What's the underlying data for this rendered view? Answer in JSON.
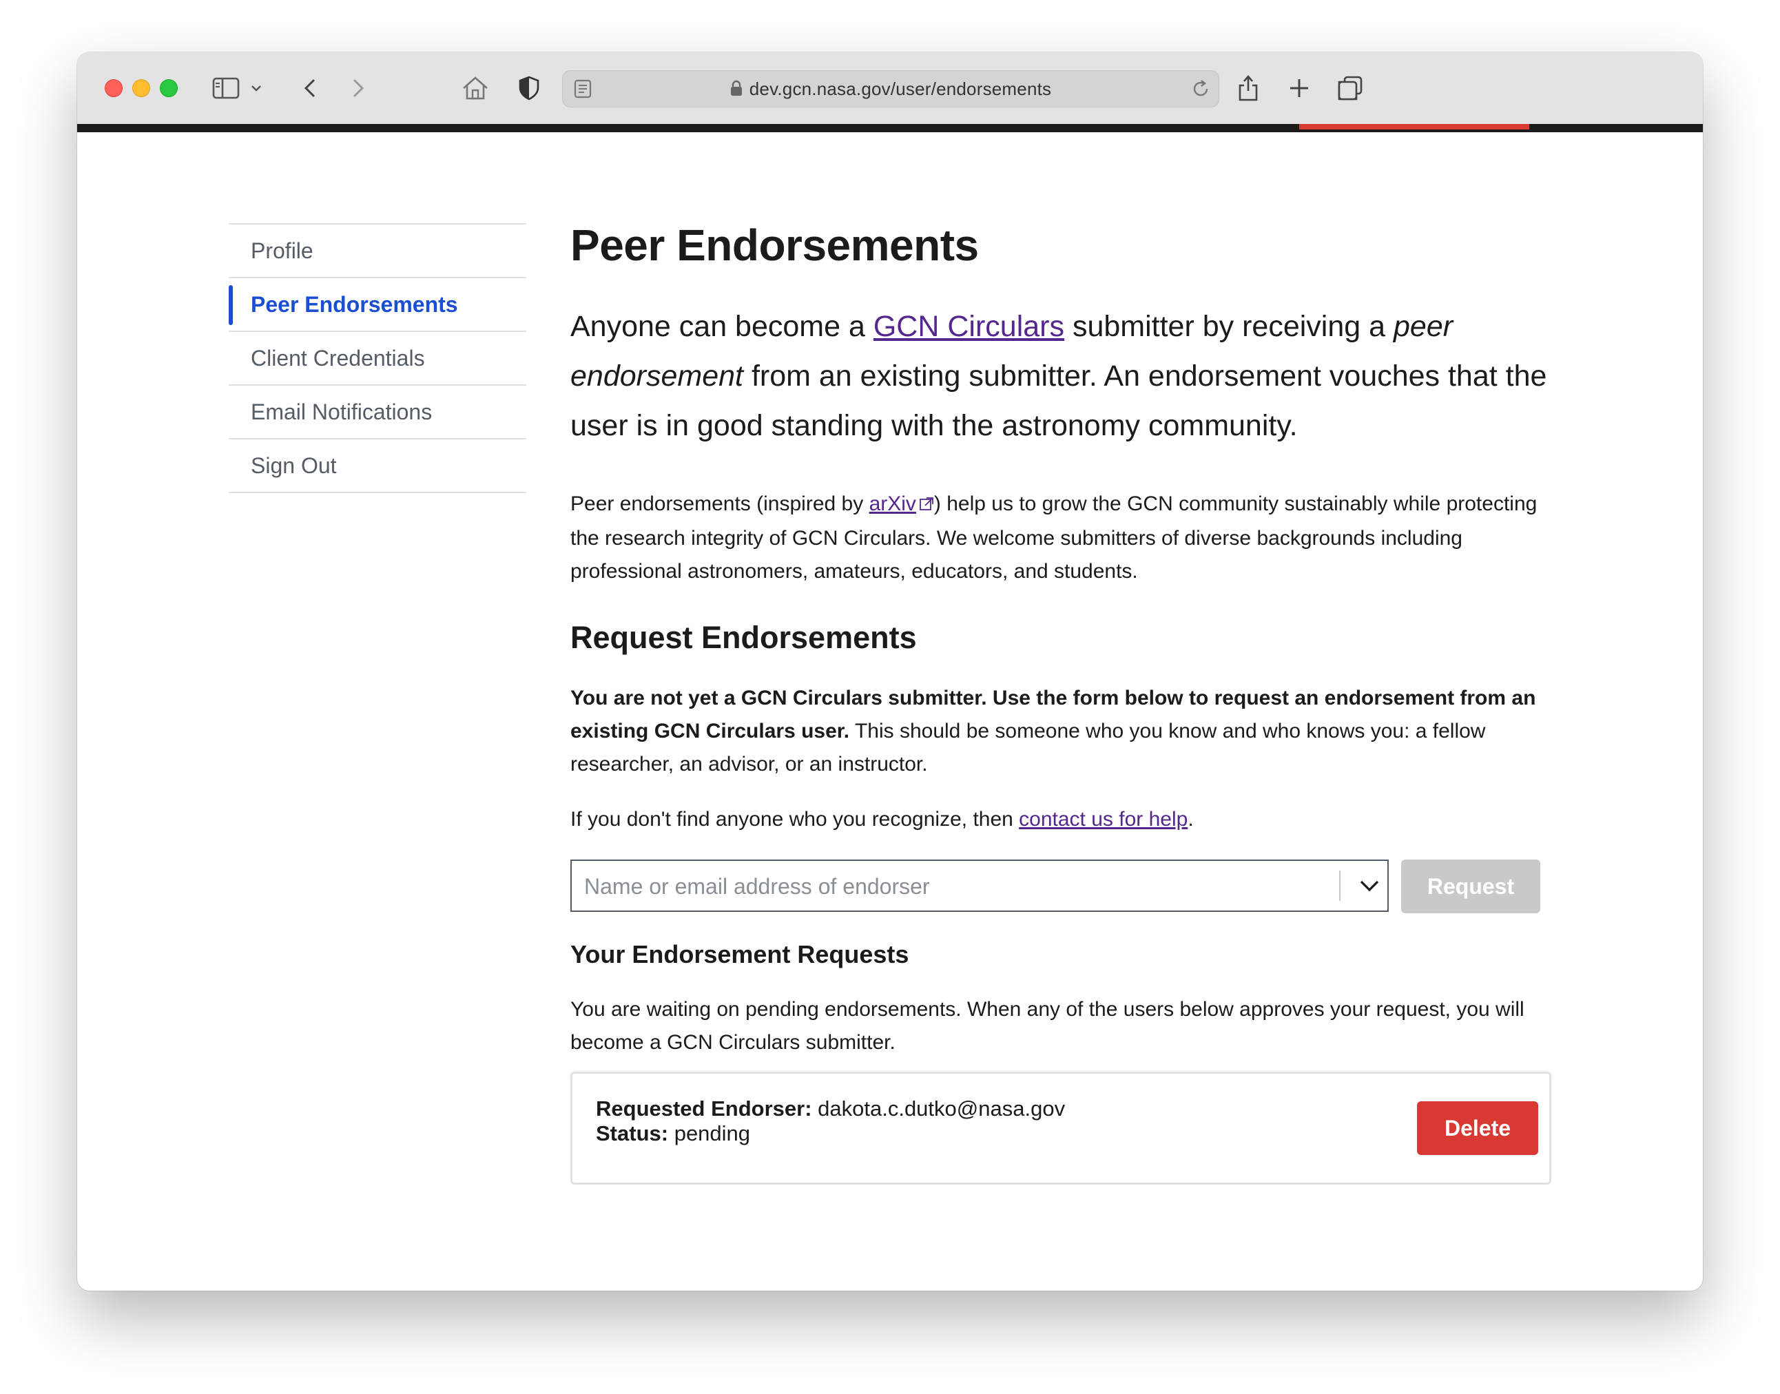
{
  "browser": {
    "url": "dev.gcn.nasa.gov/user/endorsements"
  },
  "sidebar": {
    "items": [
      {
        "label": "Profile"
      },
      {
        "label": "Peer Endorsements"
      },
      {
        "label": "Client Credentials"
      },
      {
        "label": "Email Notifications"
      },
      {
        "label": "Sign Out"
      }
    ],
    "active_index": 1
  },
  "main": {
    "title": "Peer Endorsements",
    "lead": {
      "part1": "Anyone can become a ",
      "link": "GCN Circulars",
      "part2": " submitter by receiving a ",
      "em": "peer endorsement",
      "part3": " from an existing submitter. An endorsement vouches that the user is in good standing with the astronomy community."
    },
    "intro": {
      "part1": "Peer endorsements (inspired by ",
      "link": "arXiv",
      "part2": ") help us to grow the GCN community sustainably while protecting the research integrity of GCN Circulars. We welcome submitters of diverse backgrounds including professional astronomers, amateurs, educators, and students."
    },
    "request_heading": "Request Endorsements",
    "request_bold": "You are not yet a GCN Circulars submitter. Use the form below to request an endorsement from an existing GCN Circulars user.",
    "request_rest": " This should be someone who you know and who knows you: a fellow researcher, an advisor, or an instructor.",
    "help": {
      "part1": "If you don't find anyone who you recognize, then ",
      "link": "contact us for help",
      "part2": "."
    },
    "search": {
      "placeholder": "Name or email address of endorser",
      "value": ""
    },
    "request_button": "Request",
    "your_requests_heading": "Your Endorsement Requests",
    "waiting_text": "You are waiting on pending endorsements. When any of the users below approves your request, you will become a GCN Circulars submitter.",
    "requests": [
      {
        "endorser_label": "Requested Endorser:",
        "endorser": "dakota.c.dutko@nasa.gov",
        "status_label": "Status:",
        "status": "pending",
        "delete_label": "Delete"
      }
    ]
  },
  "colors": {
    "accent_nav": "#1a4fd3",
    "link": "#54278f",
    "danger": "#d83933",
    "disabled": "#c9c9c9"
  }
}
